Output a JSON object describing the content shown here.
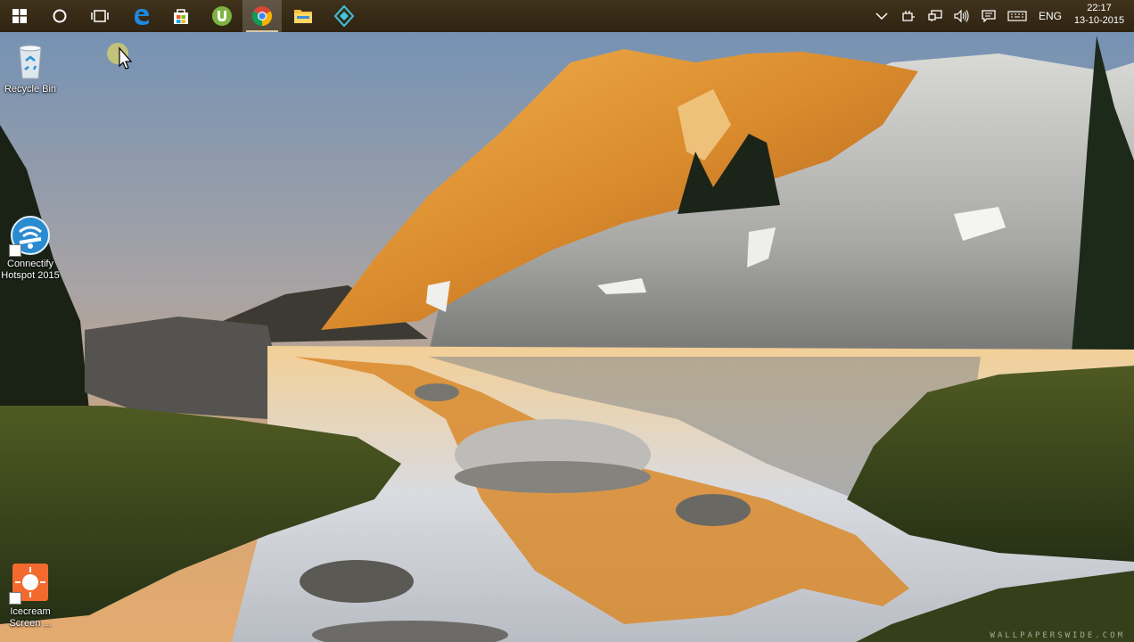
{
  "taskbar": {
    "apps": [
      {
        "name": "start-button",
        "icon": "windows-logo-icon"
      },
      {
        "name": "cortana-search-button",
        "icon": "search-circle-icon"
      },
      {
        "name": "task-view-button",
        "icon": "task-view-icon"
      },
      {
        "name": "edge-button",
        "icon": "edge-icon"
      },
      {
        "name": "store-button",
        "icon": "store-icon"
      },
      {
        "name": "utorrent-button",
        "icon": "utorrent-icon"
      },
      {
        "name": "chrome-button",
        "icon": "chrome-icon",
        "active": true
      },
      {
        "name": "file-explorer-button",
        "icon": "folder-icon"
      },
      {
        "name": "app-diamond-button",
        "icon": "diamond-app-icon"
      }
    ],
    "tray": {
      "language": "ENG",
      "time": "22:17",
      "date": "13-10-2015"
    },
    "colors": {
      "bar": "#3a2d17",
      "active": "#d9c9a8"
    }
  },
  "desktop": {
    "icons": [
      {
        "label": "Recycle Bin",
        "icon": "recycle-bin-icon"
      },
      {
        "label": "Connectify Hotspot 2015",
        "icon": "connectify-wifi-icon"
      },
      {
        "label": "Icecream Screen ...",
        "icon": "icecream-recorder-icon"
      }
    ],
    "watermark": "WALLPAPERSWIDE.COM"
  }
}
